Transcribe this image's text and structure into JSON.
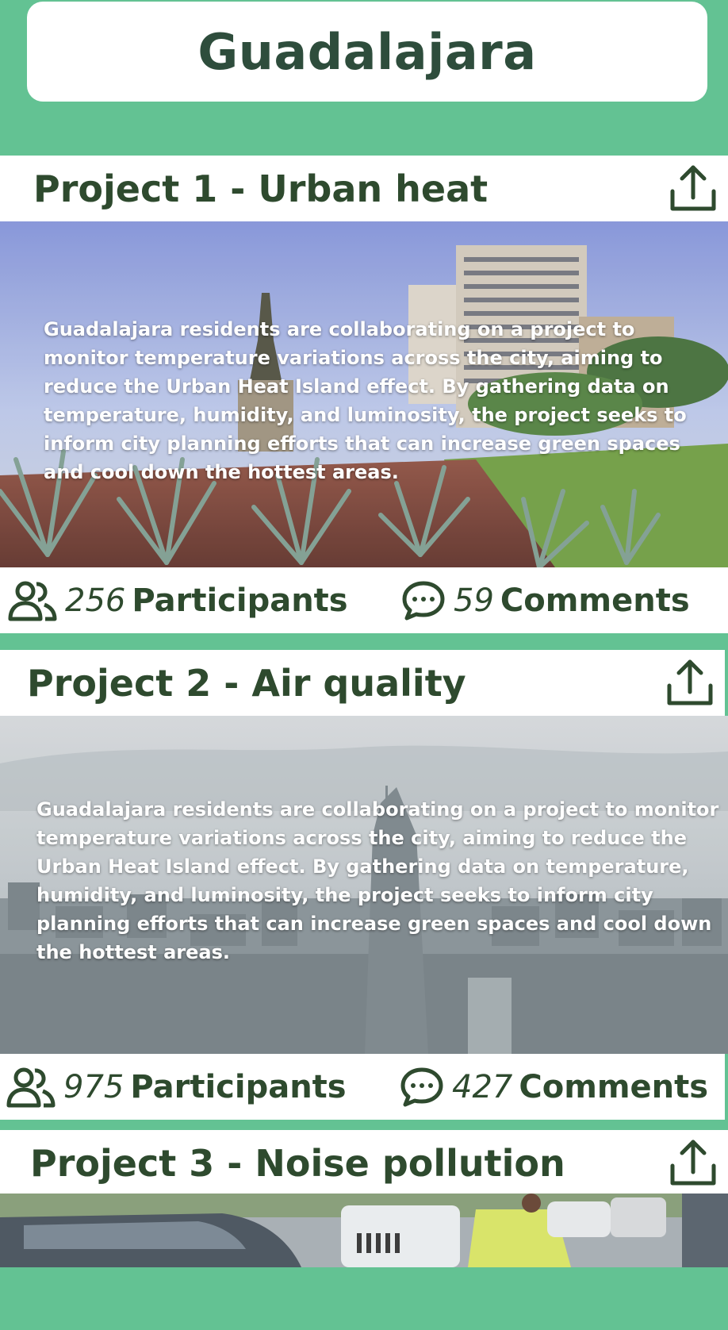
{
  "city": {
    "title": "Guadalajara"
  },
  "projects": [
    {
      "title": "Project 1 - Urban heat",
      "description": "Guadalajara residents are collaborating on a project to monitor temperature variations across the city, aiming to reduce the Urban Heat Island effect. By gathering data on temperature, humidity, and luminosity, the project seeks to inform city planning efforts that can increase green spaces and cool down the hottest areas.",
      "participants_count": "256",
      "participants_label": "Participants",
      "comments_count": "59",
      "comments_label": "Comments"
    },
    {
      "title": "Project 2 - Air quality",
      "description": "Guadalajara residents are collaborating on a project to monitor temperature variations across the city, aiming to reduce the Urban Heat Island effect. By gathering data on temperature, humidity, and luminosity, the project seeks to inform city planning efforts that can increase green spaces and cool down the hottest areas.",
      "participants_count": "975",
      "participants_label": "Participants",
      "comments_count": "427",
      "comments_label": "Comments"
    },
    {
      "title": "Project 3 - Noise pollution"
    }
  ],
  "icons": {
    "share": "share-icon",
    "participants": "users-icon",
    "comments": "comment-icon"
  },
  "colors": {
    "background": "#63c293",
    "text_dark": "#2e4a2e",
    "card": "#ffffff"
  }
}
